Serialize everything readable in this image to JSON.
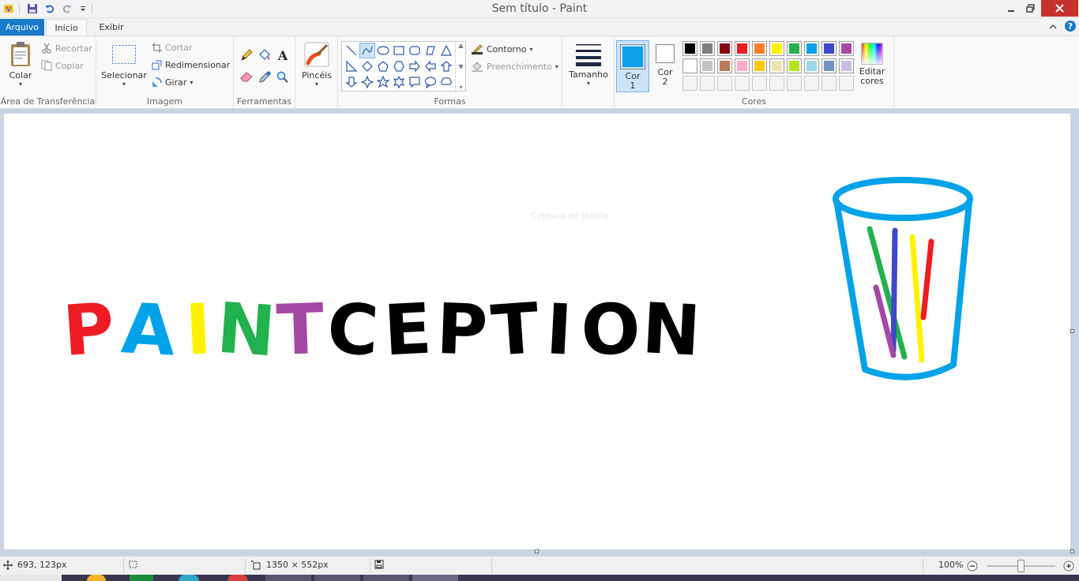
{
  "window": {
    "title": "Sem título - Paint"
  },
  "tabs": {
    "file": "Arquivo",
    "home": "Início",
    "view": "Exibir"
  },
  "clipboard": {
    "paste": "Colar",
    "cut": "Recortar",
    "copy": "Copiar",
    "label": "Área de Transferência"
  },
  "image": {
    "select": "Selecionar",
    "crop": "Cortar",
    "resize": "Redimensionar",
    "rotate": "Girar",
    "label": "Imagem"
  },
  "tools": {
    "label": "Ferramentas"
  },
  "brushes": {
    "label": "Pincéis"
  },
  "shapes": {
    "outline": "Contorno",
    "fill": "Preenchimento",
    "label": "Formas"
  },
  "size": {
    "label": "Tamanho"
  },
  "colors": {
    "color1_line1": "Cor",
    "color1_line2": "1",
    "color2_line1": "Cor",
    "color2_line2": "2",
    "edit_line1": "Editar",
    "edit_line2": "cores",
    "label": "Cores",
    "color1": "#0ea0e8",
    "color2": "#ffffff",
    "palette": [
      "#000000",
      "#7f7f7f",
      "#880015",
      "#ed1c24",
      "#ff7f27",
      "#fff200",
      "#22b14c",
      "#00a2e8",
      "#3f48cc",
      "#a349a4",
      "#ffffff",
      "#c3c3c3",
      "#b97a57",
      "#ffaec9",
      "#ffc90e",
      "#efe4b0",
      "#b5e61d",
      "#99d9ea",
      "#7092be",
      "#c8bfe7"
    ]
  },
  "canvas": {
    "faint_text": "Captura de Janela",
    "word_letters": [
      {
        "ch": "P",
        "color": "#ed1c24"
      },
      {
        "ch": "A",
        "color": "#00a2e8"
      },
      {
        "ch": "I",
        "color": "#fff200"
      },
      {
        "ch": "N",
        "color": "#22b14c"
      },
      {
        "ch": "T",
        "color": "#a349a4"
      },
      {
        "ch": "C",
        "color": "#000000"
      },
      {
        "ch": "E",
        "color": "#000000"
      },
      {
        "ch": "P",
        "color": "#000000"
      },
      {
        "ch": "T",
        "color": "#000000"
      },
      {
        "ch": "I",
        "color": "#000000"
      },
      {
        "ch": "O",
        "color": "#000000"
      },
      {
        "ch": "N",
        "color": "#000000"
      }
    ]
  },
  "status": {
    "cursor_pos": "693, 123px",
    "image_size": "1350 × 552px",
    "zoom": "100%"
  }
}
